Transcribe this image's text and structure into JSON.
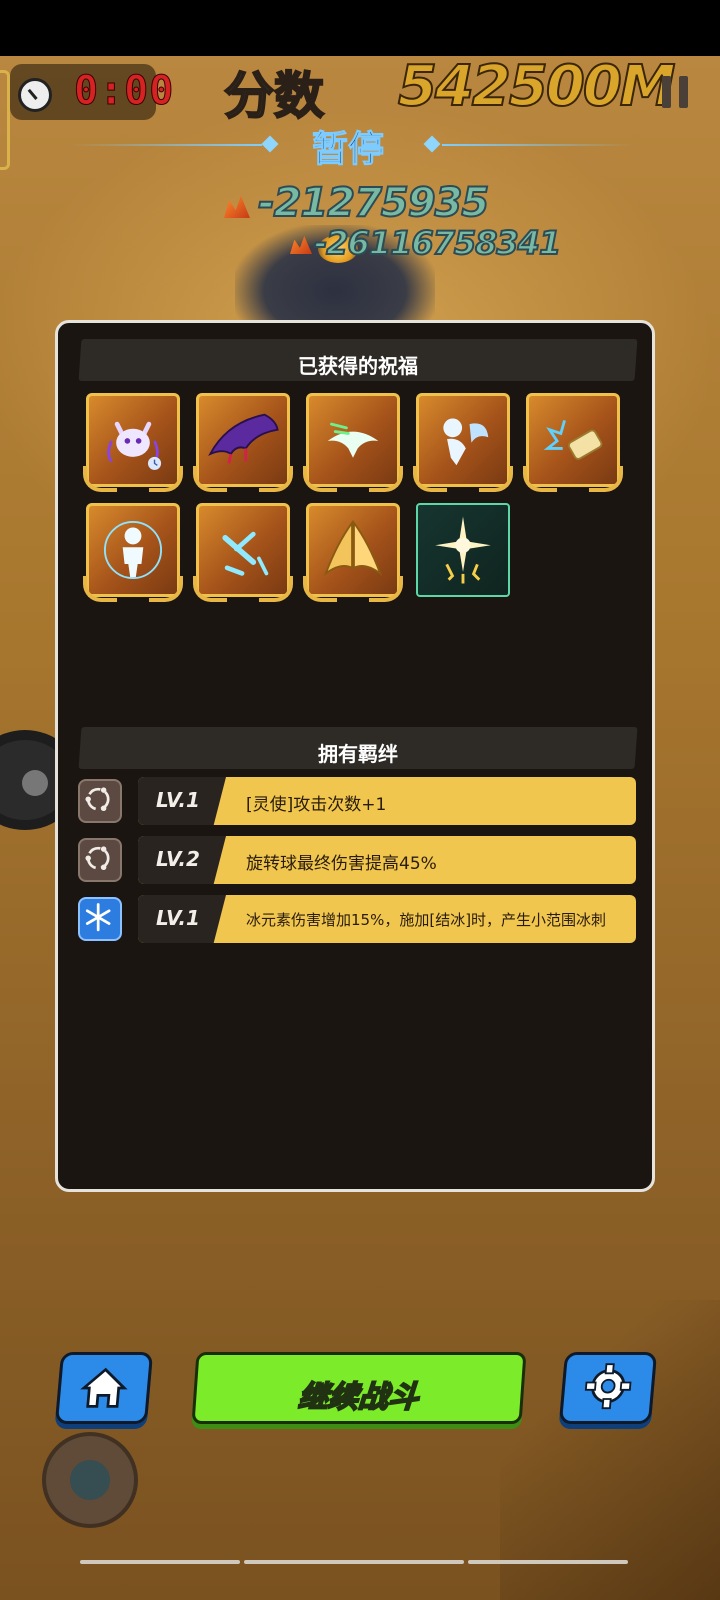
{
  "hud": {
    "timer": "0:00",
    "score_label": "分数",
    "score_value": "542500M",
    "pause_title": "暂停",
    "damage_numbers": [
      "-21275935",
      "-26116758341"
    ]
  },
  "panel": {
    "blessings_title": "已获得的祝福",
    "blessings": [
      {
        "icon": "demon-mask-icon"
      },
      {
        "icon": "bat-wings-icon"
      },
      {
        "icon": "winged-dash-icon"
      },
      {
        "icon": "spirit-angel-icon"
      },
      {
        "icon": "ice-scroll-icon"
      },
      {
        "icon": "lightning-figure-icon"
      },
      {
        "icon": "scattered-bones-icon"
      },
      {
        "icon": "golden-wings-icon"
      },
      {
        "icon": "radiant-star-icon"
      }
    ],
    "bonds_title": "拥有羁绊",
    "bonds": [
      {
        "icon": "orbit-icon",
        "level": "LV.1",
        "text": "[灵使]攻击次数+1"
      },
      {
        "icon": "orbit-icon",
        "level": "LV.2",
        "text": "旋转球最终伤害提高45%"
      },
      {
        "icon": "snowflake-icon",
        "level": "LV.1",
        "text": "冰元素伤害增加15%，施加[结冰]时，产生小范围冰刺"
      }
    ]
  },
  "actions": {
    "continue_label": "继续战斗"
  },
  "colors": {
    "panel_bg": "#1a1510",
    "bond_bar": "#f0c64e",
    "continue_button": "#7cec2a",
    "icon_button": "#2c8be8",
    "timer": "#d52323",
    "score": "#d9a52a"
  }
}
